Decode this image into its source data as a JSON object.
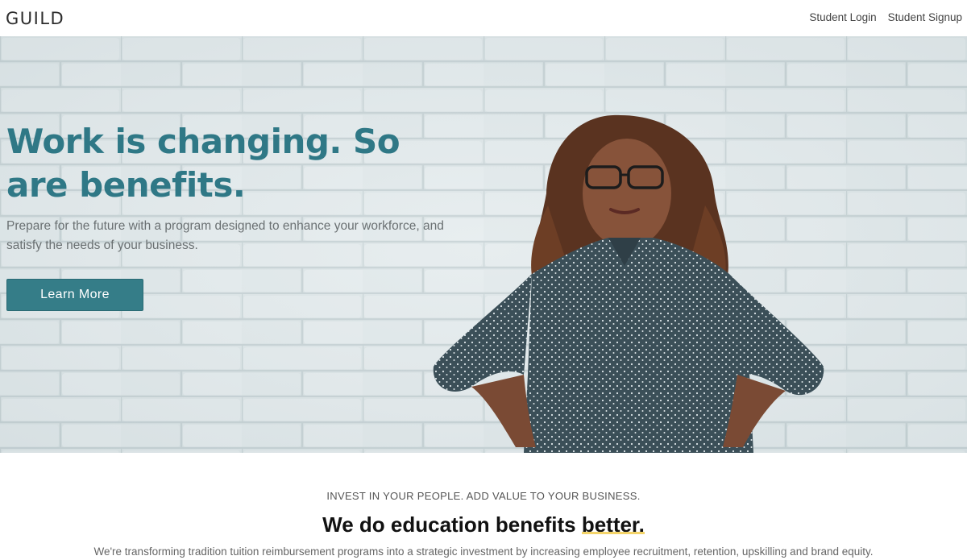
{
  "header": {
    "logo_text": "GUILD",
    "nav": [
      {
        "label": "Student Login"
      },
      {
        "label": "Student Signup"
      }
    ]
  },
  "hero": {
    "title": "Work is changing. So are benefits.",
    "subtitle": "Prepare for the future with a program designed to enhance your workforce, and satisfy the needs of your business.",
    "cta_label": "Learn More"
  },
  "value_section": {
    "eyebrow": "INVEST IN YOUR PEOPLE. ADD VALUE TO YOUR BUSINESS.",
    "title_prefix": "We do education benefits ",
    "title_highlight": "better.",
    "body": "We're transforming tradition tuition reimbursement programs into a strategic investment by increasing employee recruitment, retention, upskilling and brand equity."
  },
  "colors": {
    "accent": "#357d88",
    "title_teal": "#2f7886",
    "highlight_yellow": "#f2cc4f"
  }
}
